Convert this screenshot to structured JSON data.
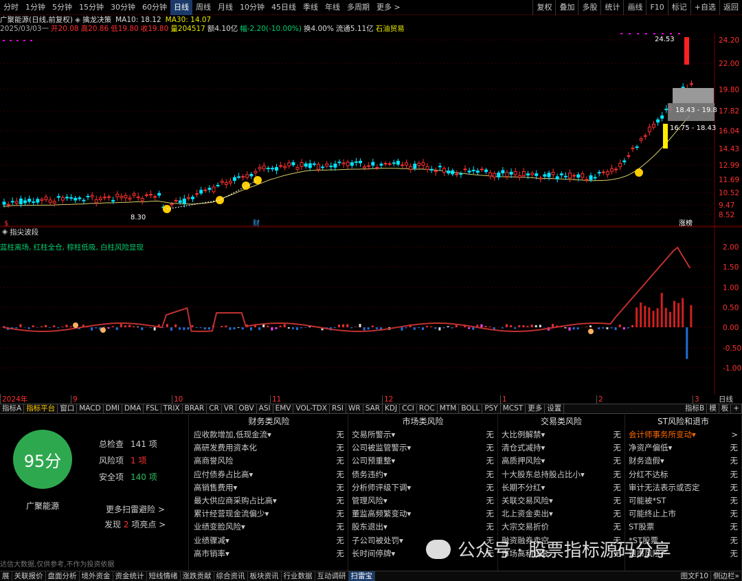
{
  "topbar": {
    "tabs": [
      "分时",
      "1分钟",
      "5分钟",
      "15分钟",
      "30分钟",
      "60分钟",
      "日线",
      "周线",
      "月线",
      "10分钟",
      "45日线",
      "季线",
      "年线",
      "多周期",
      "更多 >"
    ],
    "active_tab": "日线",
    "right_buttons": [
      "复权",
      "叠加",
      "多股",
      "统计",
      "画线",
      "F10",
      "标记",
      "+自选",
      "返回"
    ]
  },
  "info1": {
    "name": "广聚能源(日线,前复权)",
    "strategy": "擒龙决策",
    "ma10": "MA10: 18.12",
    "ma30": "MA30: 14.07"
  },
  "info2": {
    "date": "2025/03/03一",
    "open": "开20.08",
    "high": "高20.86",
    "low": "低19.80",
    "close": "收19.80",
    "volume": "量204517",
    "amount": "额4.10亿",
    "change": "幅-2.20(-10.00%)",
    "turnover": "换4.00%",
    "float": "流通5.11亿",
    "sector": "石油贸易"
  },
  "mainchart": {
    "price_labels": [
      "24.20",
      "22.00",
      "19.80",
      "17.82",
      "16.04",
      "14.43",
      "12.99",
      "11.69",
      "10.52",
      "9.47",
      "8.52"
    ],
    "annotations": {
      "high_label": "24.53",
      "low_label": "8.30",
      "box1": "18.43 - 19.8",
      "box2": "16.75 - 18.43",
      "marker_cai": "财",
      "marker_zt": "涨榜",
      "marker_s": "$"
    },
    "colors": {
      "up": "#ff3030",
      "down": "#00e5ff",
      "ma": "#d8cc6a",
      "grid": "#3a0000"
    }
  },
  "indicator": {
    "name": "指尖波段",
    "subtitle": "蓝柱离场, 红柱全仓, 棕柱低吸, 白柱风险显现",
    "axis_labels": [
      "2.00",
      "1.50",
      "1.00",
      "0.50",
      "0.00",
      "-0.50",
      "-1.00"
    ]
  },
  "axisbar": {
    "labels": [
      "2024年",
      "9",
      "10",
      "11",
      "12",
      "1",
      "2",
      "3"
    ],
    "right": "日线"
  },
  "indtabs": {
    "items": [
      "指标A",
      "指标平台",
      "窗口",
      "MACD",
      "DMI",
      "DMA",
      "FSL",
      "TRIX",
      "BRAR",
      "CR",
      "VR",
      "OBV",
      "ASI",
      "EMV",
      "VOL-TDX",
      "RSI",
      "WR",
      "SAR",
      "KDJ",
      "CCI",
      "ROC",
      "MTM",
      "BOLL",
      "PSY",
      "MCST",
      "更多",
      "设置"
    ],
    "active": "指标平台",
    "right": [
      "指标B",
      "模",
      "板",
      "+"
    ]
  },
  "panel": {
    "score": "95分",
    "stock_name": "广聚能源",
    "stats": [
      {
        "label": "总检查",
        "value": "141 项"
      },
      {
        "label": "风险项",
        "value": "1 项"
      },
      {
        "label": "安全项",
        "value": "140 项"
      }
    ],
    "more_link": "更多扫雷避险 >",
    "found": "发现",
    "found_count": "2",
    "found_suffix": "项亮点 >",
    "disclaimer": "达信大数据,仅供参考,不作为投资依据",
    "columns": [
      {
        "title": "财务类风险",
        "items": [
          [
            "应收款增加,低现金流▾",
            "无"
          ],
          [
            "高研发费用资本化",
            "无"
          ],
          [
            "高商誉风险",
            "无"
          ],
          [
            "应付债券占比高▾",
            "无"
          ],
          [
            "高销售费用▾",
            "无"
          ],
          [
            "最大供应商采购占比高▾",
            "无"
          ],
          [
            "累计经营现金流偏少▾",
            "无"
          ],
          [
            "业绩变脸风险▾",
            "无"
          ],
          [
            "业绩骤减▾",
            "无"
          ],
          [
            "高市销率▾",
            "无"
          ]
        ]
      },
      {
        "title": "市场类风险",
        "items": [
          [
            "交易所警示▾",
            "无"
          ],
          [
            "公司被监管警示▾",
            "无"
          ],
          [
            "公司预重整▾",
            "无"
          ],
          [
            "债务违约▾",
            "无"
          ],
          [
            "分析师评级下调▾",
            "无"
          ],
          [
            "管理风险▾",
            "无"
          ],
          [
            "董监高频繁变动▾",
            "无"
          ],
          [
            "股东退出▾",
            "无"
          ],
          [
            "子公司被处罚▾",
            "无"
          ],
          [
            "长时间停牌▾",
            "无"
          ]
        ]
      },
      {
        "title": "交易类风险",
        "items": [
          [
            "大比例解禁▾",
            "无"
          ],
          [
            "清仓式减持▾",
            "无"
          ],
          [
            "高质押风险▾",
            "无"
          ],
          [
            "十大股东总持股占比小▾",
            "无"
          ],
          [
            "长期不分红▾",
            "无"
          ],
          [
            "关联交易风险▾",
            "无"
          ],
          [
            "北上资金卖出▾",
            "无"
          ],
          [
            "大宗交易折价",
            "无"
          ],
          [
            "融资融券卖空",
            "无"
          ],
          [
            "市场高利润套",
            "无"
          ]
        ]
      },
      {
        "title": "ST风险和退市",
        "items": [
          [
            "会计师事务所变动▾",
            ">"
          ],
          [
            "净资产偏低▾",
            "无"
          ],
          [
            "财务造假▾",
            "无"
          ],
          [
            "分红不达标",
            "无"
          ],
          [
            "审计无法表示或否定",
            "无"
          ],
          [
            "可能被*ST",
            "无"
          ],
          [
            "可能终止上市",
            "无"
          ],
          [
            "ST股票",
            "无"
          ],
          [
            "*ST股票",
            "无"
          ],
          [
            "退市风险",
            "无"
          ]
        ]
      }
    ]
  },
  "watermark": "公众号 · 股票指标源码分享",
  "bottombar": {
    "items": [
      "展",
      "关联报价",
      "盘面分析",
      "境外资金",
      "资金统计",
      "短线情绪",
      "涨跌贡献",
      "综合资讯",
      "板块资讯",
      "行业数据",
      "互动调研",
      "扫雷宝"
    ],
    "active": "扫雷宝",
    "right": [
      "图文F10",
      "侧边栏»"
    ]
  }
}
